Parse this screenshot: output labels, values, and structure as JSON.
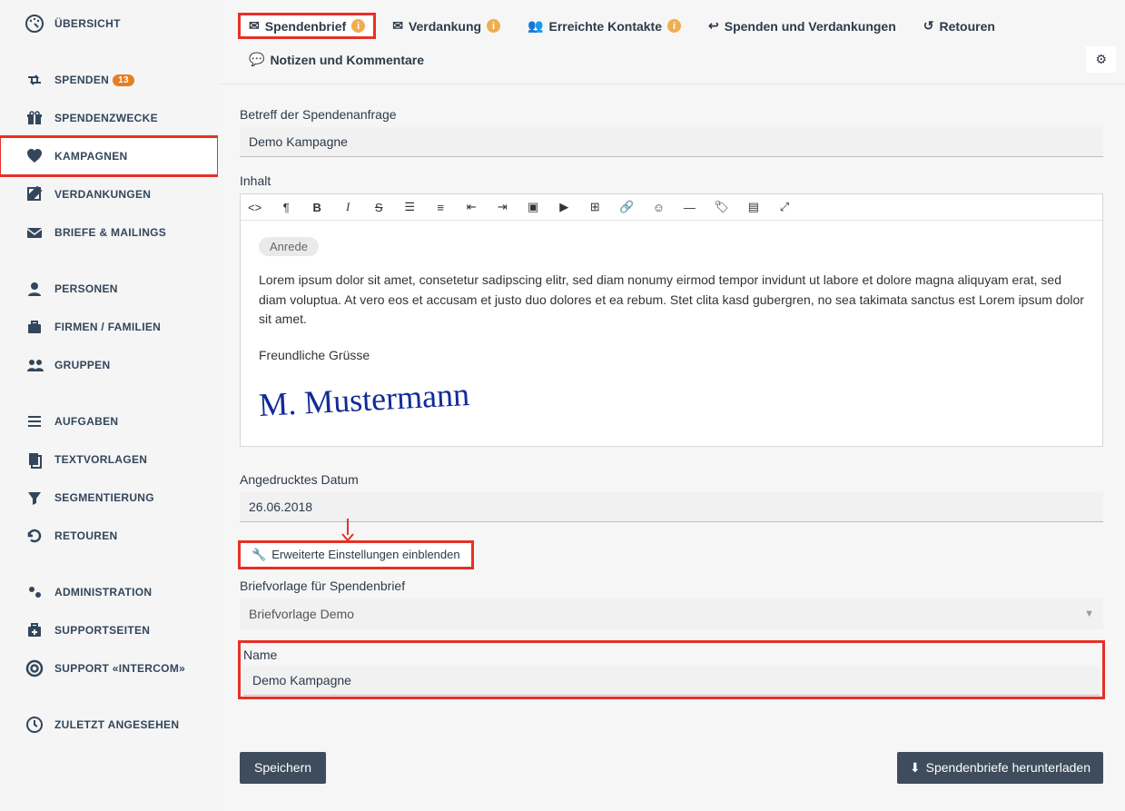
{
  "sidebar": {
    "items": [
      {
        "label": "ÜBERSICHT",
        "icon": "dashboard"
      },
      {
        "label": "SPENDEN",
        "icon": "retweet",
        "badge": "13"
      },
      {
        "label": "SPENDENZWECKE",
        "icon": "gift"
      },
      {
        "label": "KAMPAGNEN",
        "icon": "heart",
        "active": true
      },
      {
        "label": "VERDANKUNGEN",
        "icon": "edit"
      },
      {
        "label": "BRIEFE & MAILINGS",
        "icon": "envelope"
      },
      {
        "label": "PERSONEN",
        "icon": "user"
      },
      {
        "label": "FIRMEN / FAMILIEN",
        "icon": "briefcase"
      },
      {
        "label": "GRUPPEN",
        "icon": "users"
      },
      {
        "label": "AUFGABEN",
        "icon": "list"
      },
      {
        "label": "TEXTVORLAGEN",
        "icon": "copy"
      },
      {
        "label": "SEGMENTIERUNG",
        "icon": "filter"
      },
      {
        "label": "RETOUREN",
        "icon": "undo"
      },
      {
        "label": "ADMINISTRATION",
        "icon": "cogs"
      },
      {
        "label": "SUPPORTSEITEN",
        "icon": "medkit"
      },
      {
        "label": "SUPPORT «INTERCOM»",
        "icon": "life-ring"
      },
      {
        "label": "ZULETZT ANGESEHEN",
        "icon": "clock"
      }
    ]
  },
  "tabs": [
    {
      "label": "Spendenbrief",
      "icon": "envelope",
      "info": true,
      "active": true
    },
    {
      "label": "Verdankung",
      "icon": "heart-env",
      "info": true
    },
    {
      "label": "Erreichte Kontakte",
      "icon": "users",
      "info": true
    },
    {
      "label": "Spenden und Verdankungen",
      "icon": "reply-env"
    },
    {
      "label": "Retouren",
      "icon": "undo"
    },
    {
      "label": "Notizen und Kommentare",
      "icon": "comment"
    }
  ],
  "form": {
    "subject_label": "Betreff der Spendenanfrage",
    "subject_value": "Demo Kampagne",
    "content_label": "Inhalt",
    "salutation_pill": "Anrede",
    "body_text": "Lorem ipsum dolor sit amet, consetetur sadipscing elitr, sed diam nonumy eirmod tempor invidunt ut labore et dolore magna aliquyam erat, sed diam voluptua. At vero eos et accusam et justo duo dolores et ea rebum. Stet clita kasd gubergren, no sea takimata sanctus est Lorem ipsum dolor sit amet.",
    "closing": "Freundliche Grüsse",
    "signature": "M. Mustermann",
    "date_label": "Angedrucktes Datum",
    "date_value": "26.06.2018",
    "advanced_label": "Erweiterte Einstellungen einblenden",
    "template_label": "Briefvorlage für Spendenbrief",
    "template_value": "Briefvorlage Demo",
    "name_label": "Name",
    "name_value": "Demo Kampagne",
    "save_label": "Speichern",
    "download_label": "Spendenbriefe herunterladen"
  },
  "icons": {
    "dashboard": "◐",
    "retweet": "↻",
    "gift": "🎁",
    "heart": "♥",
    "edit": "✎",
    "envelope": "✉",
    "user": "▲",
    "briefcase": "▢",
    "users": "👥",
    "list": "≡",
    "copy": "❐",
    "filter": "▼",
    "undo": "↺",
    "cogs": "⚙",
    "medkit": "✚",
    "life-ring": "◯",
    "clock": "◷",
    "heart-env": "❤",
    "reply-env": "↩",
    "comment": "💬",
    "wrench": "🔧",
    "download": "⬇",
    "gear": "⚙"
  }
}
